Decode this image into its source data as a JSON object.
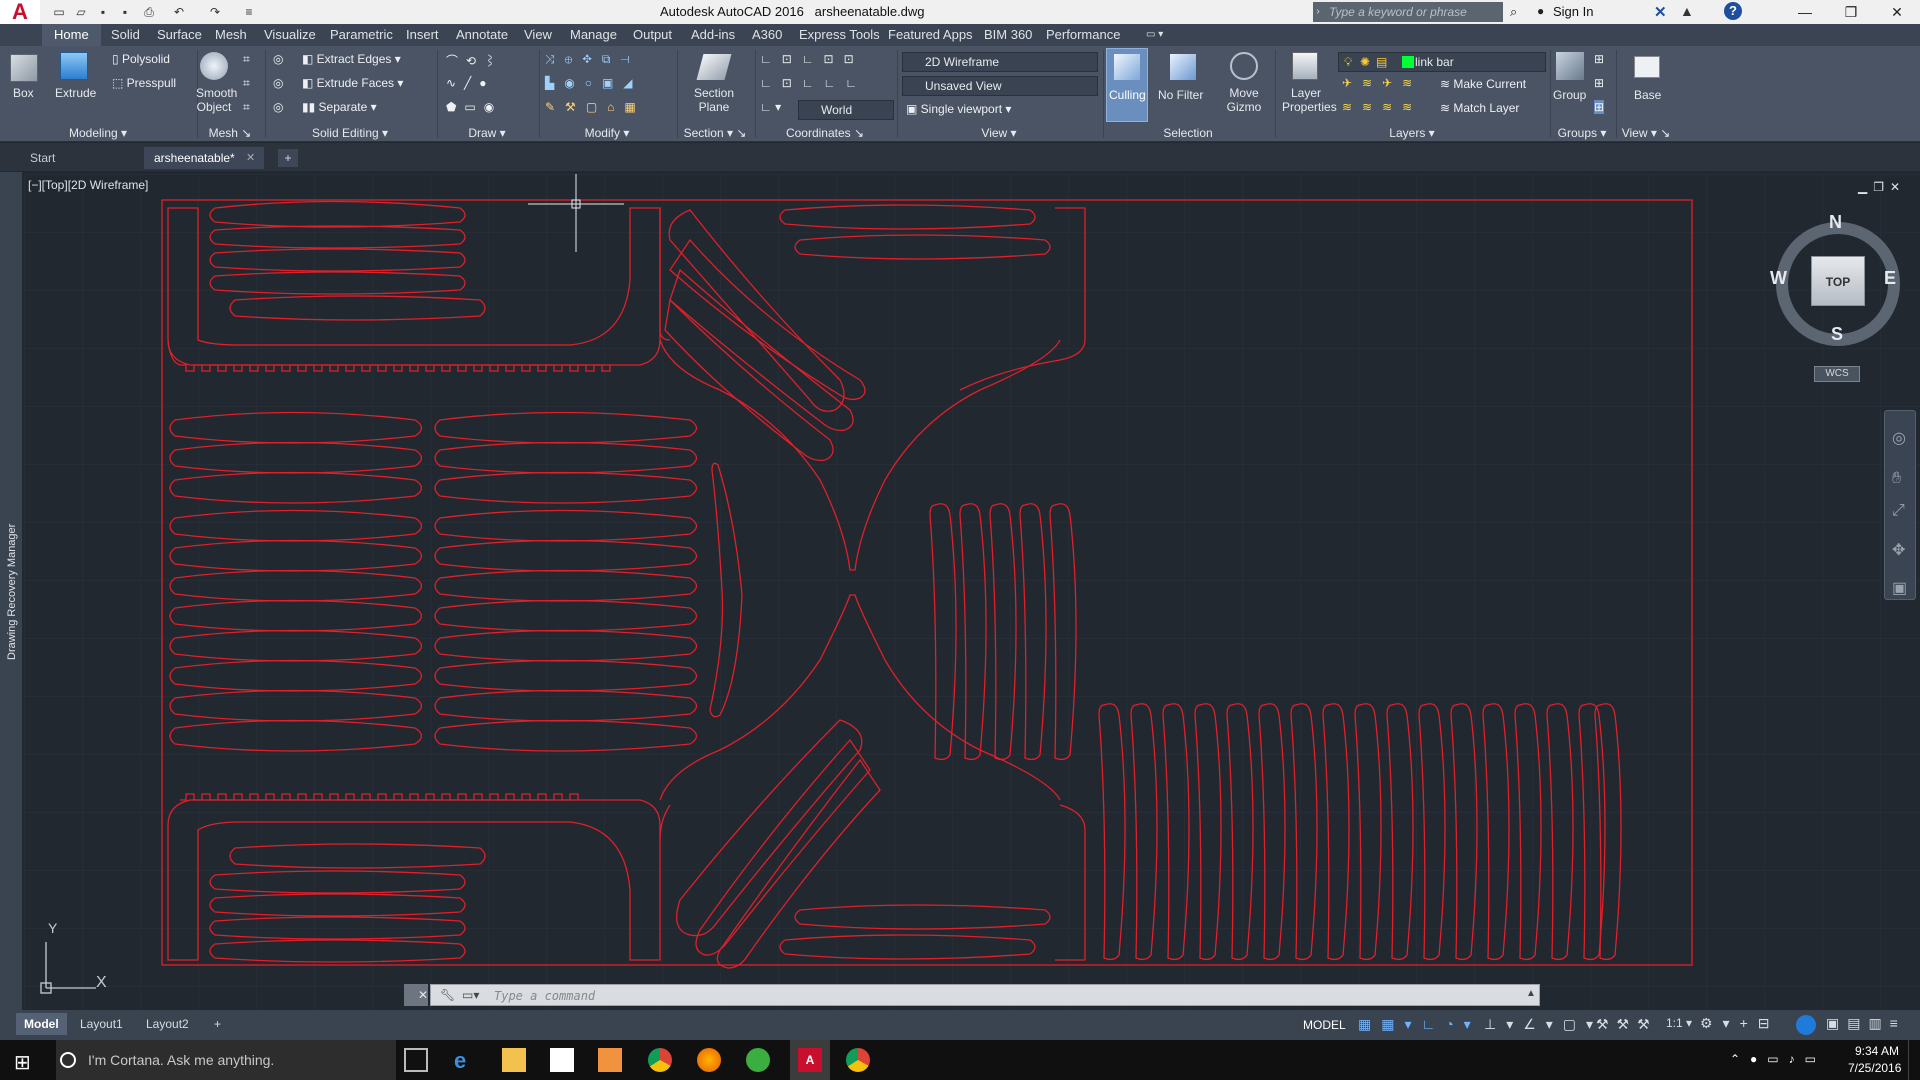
{
  "title": {
    "app": "Autodesk AutoCAD 2016",
    "file": "arsheenatable.dwg",
    "search_placeholder": "Type a keyword or phrase",
    "signin": "Sign In"
  },
  "ribbon_tabs": [
    "Home",
    "Solid",
    "Surface",
    "Mesh",
    "Visualize",
    "Parametric",
    "Insert",
    "Annotate",
    "View",
    "Manage",
    "Output",
    "Add-ins",
    "A360",
    "Express Tools",
    "Featured Apps",
    "BIM 360",
    "Performance"
  ],
  "ribbon": {
    "modeling": {
      "title": "Modeling",
      "box": "Box",
      "extrude": "Extrude",
      "polysolid": "Polysolid",
      "presspull": "Presspull"
    },
    "mesh": {
      "title": "Mesh",
      "smooth": "Smooth",
      "object": "Object"
    },
    "solid_editing": {
      "title": "Solid Editing",
      "extract_edges": "Extract Edges",
      "extrude_faces": "Extrude Faces",
      "separate": "Separate"
    },
    "draw": {
      "title": "Draw"
    },
    "modify": {
      "title": "Modify"
    },
    "section": {
      "title": "Section",
      "plane_1": "Section",
      "plane_2": "Plane"
    },
    "coordinates": {
      "title": "Coordinates",
      "world": "World"
    },
    "view": {
      "title": "View",
      "visual_style": "2D Wireframe",
      "named_view": "Unsaved View",
      "viewport": "Single viewport"
    },
    "selection": {
      "title": "Selection",
      "culling": "Culling",
      "no_filter": "No Filter",
      "move_1": "Move",
      "move_2": "Gizmo"
    },
    "layers": {
      "title": "Layers",
      "props_1": "Layer",
      "props_2": "Properties",
      "current_layer": "link bar",
      "make_current": "Make Current",
      "match_layer": "Match Layer"
    },
    "groups": {
      "title": "Groups",
      "group": "Group"
    },
    "view2": {
      "title": "View",
      "base": "Base"
    }
  },
  "file_tabs": [
    "Start",
    "arsheenatable*"
  ],
  "viewport_label": "[−][Top][2D Wireframe]",
  "side_panel": "Drawing Recovery Manager",
  "viewcube": {
    "n": "N",
    "s": "S",
    "e": "E",
    "w": "W",
    "face": "TOP",
    "wcs": "WCS"
  },
  "ucs": {
    "x": "X",
    "y": "Y"
  },
  "command_placeholder": "Type a command",
  "layout_tabs": [
    "Model",
    "Layout1",
    "Layout2"
  ],
  "status": {
    "model": "MODEL",
    "scale": "1:1"
  },
  "taskbar": {
    "cortana": "I'm Cortana. Ask me anything.",
    "time": "9:34 AM",
    "date": "7/25/2016"
  },
  "colors": {
    "drawing_line": "#e0202a",
    "canvas_bg": "#212830",
    "ribbon_bg": "#4a5464"
  }
}
